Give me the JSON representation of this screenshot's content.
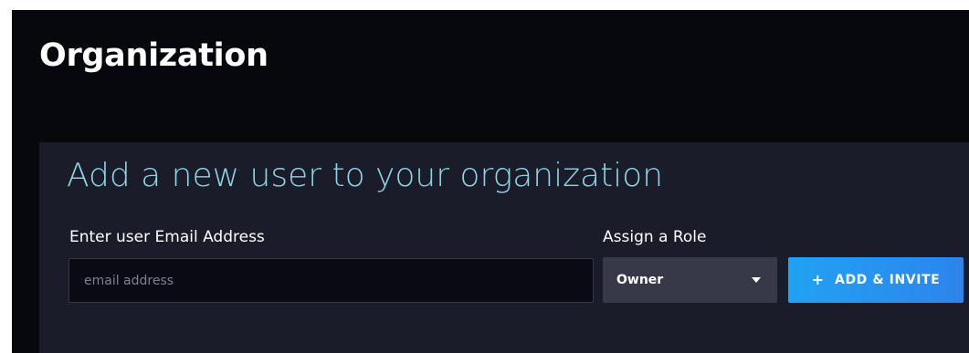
{
  "page": {
    "title": "Organization"
  },
  "panel": {
    "heading": "Add a new user to your organization",
    "email": {
      "label": "Enter user Email Address",
      "placeholder": "email address",
      "value": ""
    },
    "role": {
      "label": "Assign a Role",
      "selected": "Owner",
      "icon": "caret-down-icon"
    },
    "submit": {
      "icon": "plus-icon",
      "icon_glyph": "+",
      "label": "ADD & INVITE"
    }
  },
  "colors": {
    "background": "#07080d",
    "panel": "#1b1c29",
    "heading": "#8fd3e6",
    "input": "#0a0b12",
    "select": "#373948",
    "accent": "#2592ef"
  }
}
